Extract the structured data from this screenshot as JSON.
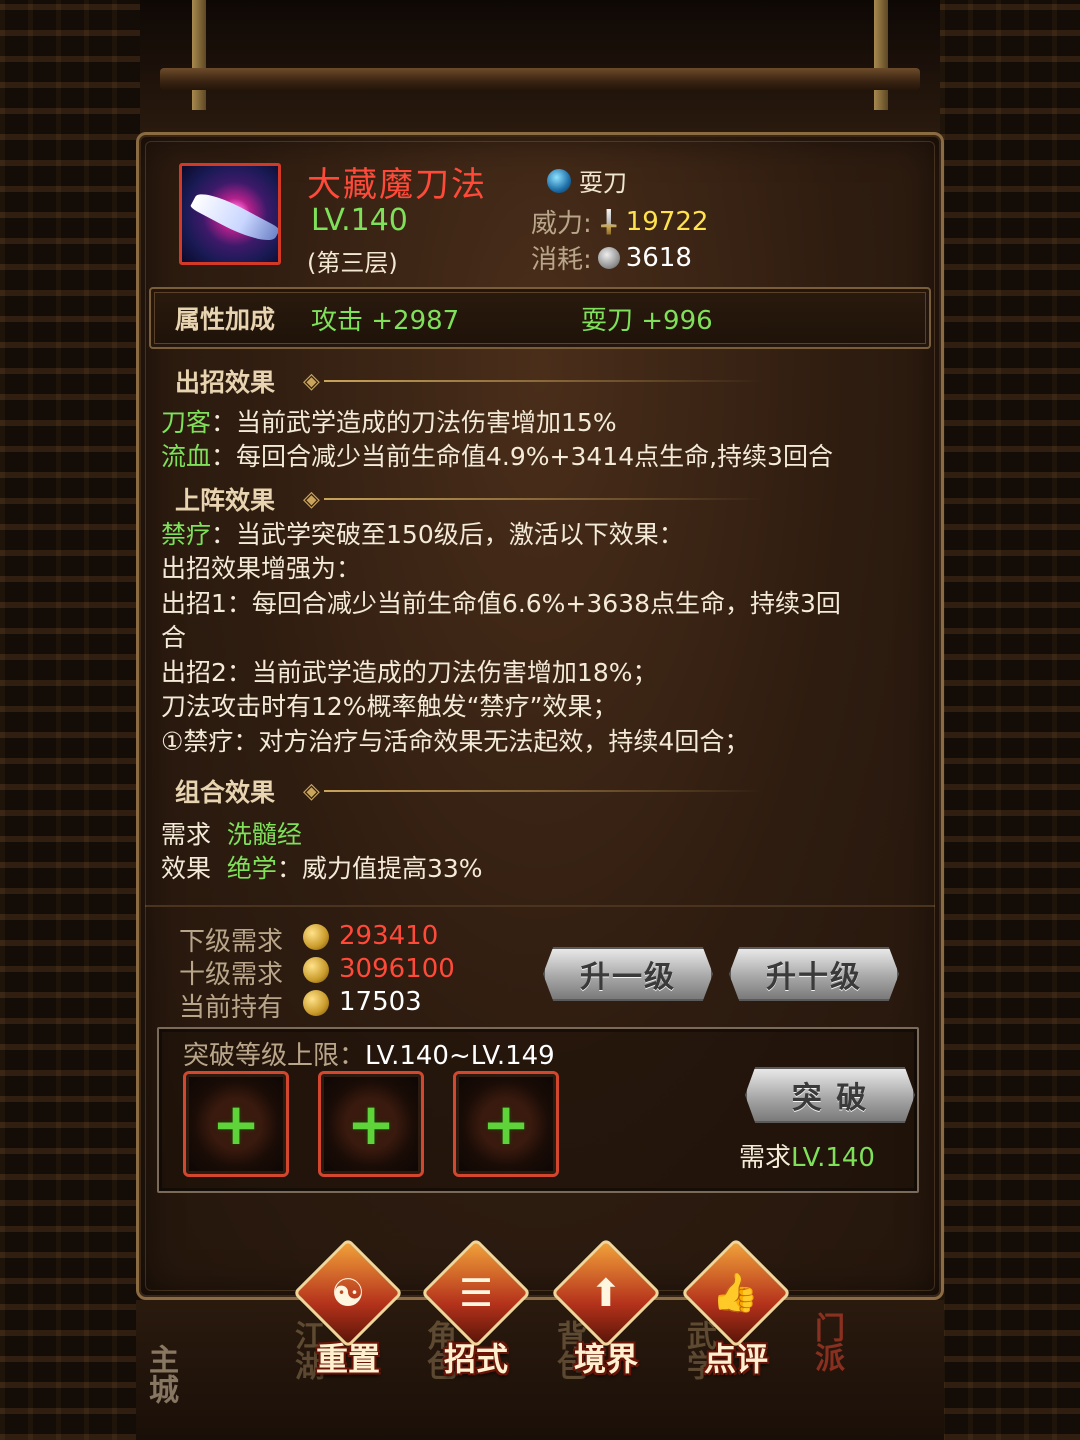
{
  "skill": {
    "name": "大藏魔刀法",
    "level": "LV.140",
    "layer": "(第三层)",
    "weapon_type": "耍刀",
    "power_label": "威力:",
    "power_value": "19722",
    "cost_label": "消耗:",
    "cost_value": "3618",
    "icon": "blade-vortex-icon"
  },
  "attributes": {
    "title": "属性加成",
    "items": [
      "攻击 +2987",
      "耍刀 +996"
    ]
  },
  "effects": {
    "attack": {
      "title": "出招效果",
      "lines": [
        {
          "tag": "刀客",
          "text": "：当前武学造成的刀法伤害增加15%"
        },
        {
          "tag": "流血",
          "text": "：每回合减少当前生命值4.9%+3414点生命,持续3回合"
        }
      ]
    },
    "deploy": {
      "title": "上阵效果",
      "first_tag": "禁疗",
      "first_text": "：当武学突破至150级后，激活以下效果：",
      "lines": [
        "出招效果增强为：",
        "出招1：每回合减少当前生命值6.6%+3638点生命，持续3回",
        "合",
        "出招2：当前武学造成的刀法伤害增加18%；",
        "刀法攻击时有12%概率触发“禁疗”效果；",
        "①禁疗：对方治疗与活命效果无法起效，持续4回合；"
      ]
    },
    "combo": {
      "title": "组合效果",
      "req_label": "需求",
      "req_value": "洗髓经",
      "effect_label": "效果",
      "effect_tag": "绝学",
      "effect_text": "：威力值提高33%"
    }
  },
  "upgrade": {
    "rows": [
      {
        "label": "下级需求",
        "value": "293410"
      },
      {
        "label": "十级需求",
        "value": "3096100"
      },
      {
        "label": "当前持有",
        "value": "17503"
      }
    ],
    "btn_up1": "升一级",
    "btn_up10": "升十级"
  },
  "breakthrough": {
    "title": "突破等级上限：",
    "range": "LV.140~LV.149",
    "button": "突 破",
    "req_label": "需求",
    "req_value": "LV.140"
  },
  "actions": [
    {
      "label": "重置",
      "icon": "reset-icon"
    },
    {
      "label": "招式",
      "icon": "scroll-icon"
    },
    {
      "label": "境界",
      "icon": "arrow-up-icon"
    },
    {
      "label": "点评",
      "icon": "thumbs-up-icon"
    }
  ],
  "bottom_nav": [
    "主城",
    "江湖",
    "角色",
    "背包",
    "武学",
    "门派"
  ],
  "colors": {
    "name": "#ff4a3a",
    "green": "#7fe05a",
    "gold": "#ffe34d",
    "panel_border": "#8a6b42"
  }
}
